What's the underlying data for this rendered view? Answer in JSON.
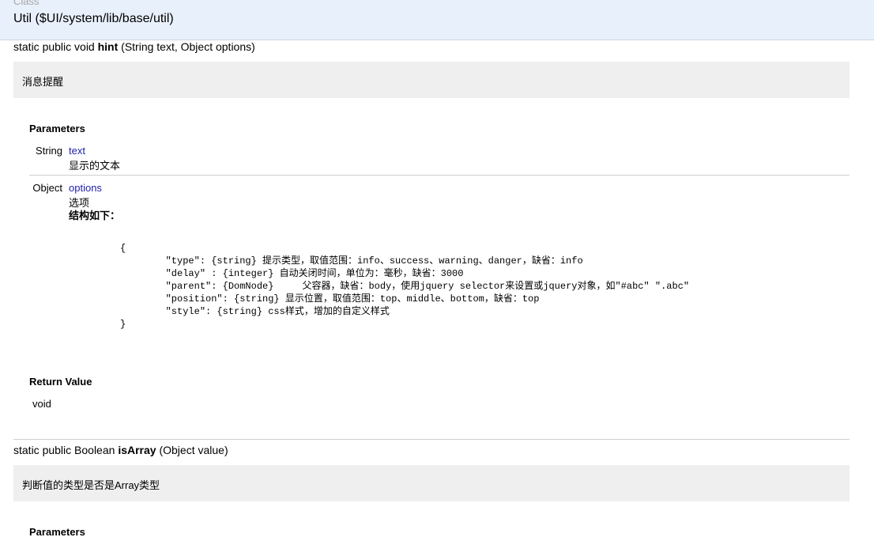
{
  "class_header": {
    "kind": "Class",
    "name": "Util ($UI/system/lib/base/util)"
  },
  "methods": [
    {
      "sig_prefix": "static public void ",
      "name": "hint",
      "sig_params": " (String text, Object options)",
      "description": "消息提醒",
      "params_title": "Parameters",
      "params": [
        {
          "type": "String",
          "name": "text",
          "desc": "显示的文本"
        },
        {
          "type": "Object",
          "name": "options",
          "desc": "选项",
          "desc_bold": "结构如下："
        }
      ],
      "code_lines": [
        "{",
        "        \"type\": {string} 提示类型，取值范围：info、success、warning、danger，缺省：info",
        "        \"delay\" : {integer} 自动关闭时间，单位为：毫秒，缺省：3000",
        "        \"parent\": {DomNode}     父容器，缺省：body，使用jquery selector来设置或jquery对象，如\"#abc\" \".abc\"",
        "        \"position\": {string} 显示位置，取值范围：top、middle、bottom，缺省：top",
        "        \"style\": {string} css样式，增加的自定义样式",
        "}"
      ],
      "return_title": "Return Value",
      "return_value": "void"
    },
    {
      "sig_prefix": "static public Boolean ",
      "name": "isArray",
      "sig_params": " (Object value)",
      "description": "判断值的类型是否是Array类型",
      "params_title": "Parameters"
    }
  ]
}
